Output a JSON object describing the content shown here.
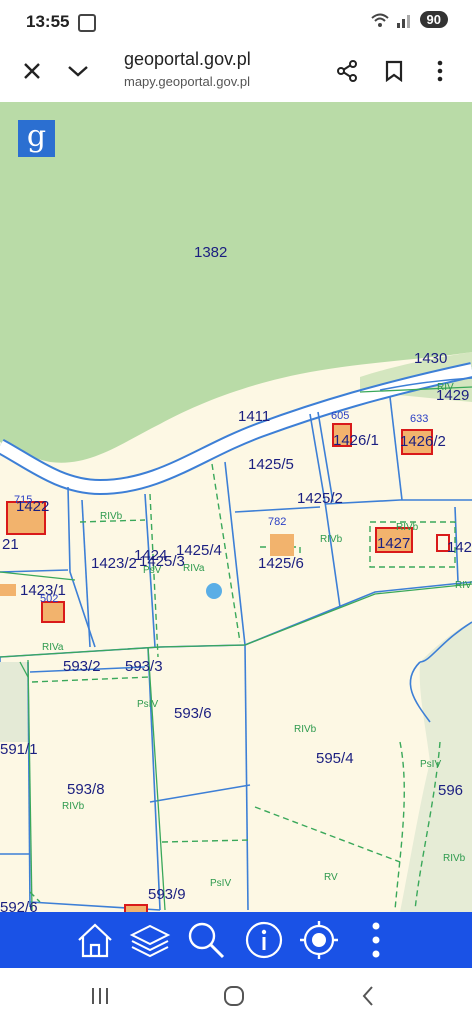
{
  "status_bar": {
    "time": "13:55",
    "battery": "90"
  },
  "browser": {
    "domain": "geoportal.gov.pl",
    "url": "mapy.geoportal.gov.pl"
  },
  "map": {
    "logo_letter": "g",
    "parcel_labels": [
      "1382",
      "1430",
      "1411",
      "1429",
      "1426/1",
      "1426/2",
      "1425/5",
      "1425/2",
      "1422",
      "21",
      "1427",
      "142",
      "1424",
      "1425/4",
      "1423/2",
      "1425/3",
      "1425/6",
      "1423/1",
      "593/2",
      "593/3",
      "593/6",
      "591/1",
      "595/4",
      "593/8",
      "596",
      "593/9",
      "592/6"
    ],
    "building_numbers": [
      "605",
      "633",
      "715",
      "782",
      "502"
    ],
    "land_use_labels": [
      "RIVb",
      "RIVb",
      "RIVb",
      "PsV",
      "RIVa",
      "RIVa",
      "PsIV",
      "RIVb",
      "RIVb",
      "PsIV",
      "RIVb",
      "PsIV",
      "RV",
      "RIV",
      "RIVb"
    ]
  },
  "toolbar": {
    "icons": [
      "home-icon",
      "layers-icon",
      "search-icon",
      "info-icon",
      "locate-icon",
      "more-icon"
    ]
  },
  "colors": {
    "forest": "#b9dba7",
    "parcel_bg": "#fdf8e4",
    "parcel_line": "#3d7fd6",
    "landuse_line": "#3aa85a",
    "label": "#1b1f80",
    "toolbar": "#1a52e6",
    "building": "#f2b36d",
    "building_outline": "#d91a1a"
  }
}
